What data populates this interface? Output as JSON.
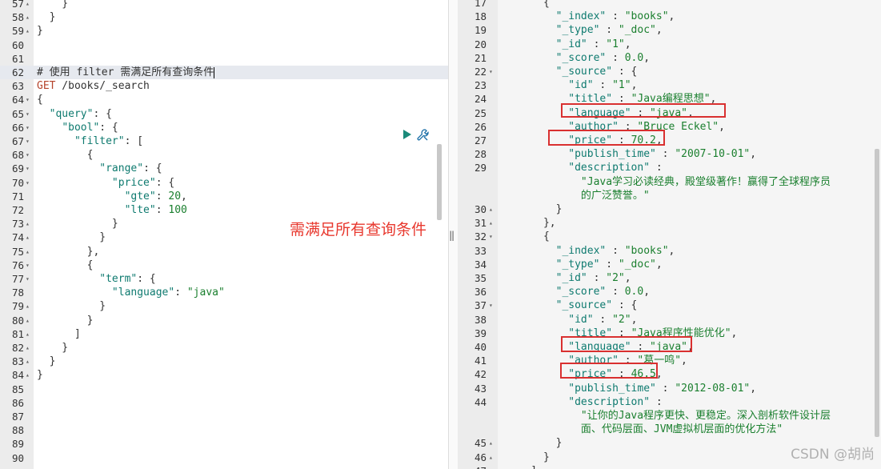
{
  "left_editor": {
    "lines": [
      {
        "n": "57",
        "fold": "▴",
        "segs": [
          {
            "t": "    }",
            "c": "p"
          }
        ]
      },
      {
        "n": "58",
        "fold": "▴",
        "segs": [
          {
            "t": "  }",
            "c": "p"
          }
        ]
      },
      {
        "n": "59",
        "fold": "▴",
        "segs": [
          {
            "t": "}",
            "c": "p"
          }
        ]
      },
      {
        "n": "60",
        "fold": "",
        "segs": []
      },
      {
        "n": "61",
        "fold": "",
        "segs": []
      },
      {
        "n": "62",
        "fold": "",
        "active": true,
        "segs": [
          {
            "t": "# 使用 filter 需满足所有查询条件",
            "c": "c"
          }
        ]
      },
      {
        "n": "63",
        "fold": "",
        "segs": [
          {
            "t": "GET",
            "c": "m"
          },
          {
            "t": " /books/_search",
            "c": "p"
          }
        ]
      },
      {
        "n": "64",
        "fold": "▾",
        "segs": [
          {
            "t": "{",
            "c": "p"
          }
        ]
      },
      {
        "n": "65",
        "fold": "▾",
        "segs": [
          {
            "t": "  ",
            "c": "p"
          },
          {
            "t": "\"query\"",
            "c": "k"
          },
          {
            "t": ": {",
            "c": "p"
          }
        ]
      },
      {
        "n": "66",
        "fold": "▾",
        "segs": [
          {
            "t": "    ",
            "c": "p"
          },
          {
            "t": "\"bool\"",
            "c": "k"
          },
          {
            "t": ": {",
            "c": "p"
          }
        ]
      },
      {
        "n": "67",
        "fold": "▾",
        "segs": [
          {
            "t": "      ",
            "c": "p"
          },
          {
            "t": "\"filter\"",
            "c": "k"
          },
          {
            "t": ": [",
            "c": "p"
          }
        ]
      },
      {
        "n": "68",
        "fold": "▾",
        "segs": [
          {
            "t": "        {",
            "c": "p"
          }
        ]
      },
      {
        "n": "69",
        "fold": "▾",
        "segs": [
          {
            "t": "          ",
            "c": "p"
          },
          {
            "t": "\"range\"",
            "c": "k"
          },
          {
            "t": ": {",
            "c": "p"
          }
        ]
      },
      {
        "n": "70",
        "fold": "▾",
        "segs": [
          {
            "t": "            ",
            "c": "p"
          },
          {
            "t": "\"price\"",
            "c": "k"
          },
          {
            "t": ": {",
            "c": "p"
          }
        ]
      },
      {
        "n": "71",
        "fold": "",
        "segs": [
          {
            "t": "              ",
            "c": "p"
          },
          {
            "t": "\"gte\"",
            "c": "k"
          },
          {
            "t": ": ",
            "c": "p"
          },
          {
            "t": "20",
            "c": "n"
          },
          {
            "t": ",",
            "c": "p"
          }
        ]
      },
      {
        "n": "72",
        "fold": "",
        "segs": [
          {
            "t": "              ",
            "c": "p"
          },
          {
            "t": "\"lte\"",
            "c": "k"
          },
          {
            "t": ": ",
            "c": "p"
          },
          {
            "t": "100",
            "c": "n"
          }
        ]
      },
      {
        "n": "73",
        "fold": "▴",
        "segs": [
          {
            "t": "            }",
            "c": "p"
          }
        ]
      },
      {
        "n": "74",
        "fold": "▴",
        "segs": [
          {
            "t": "          }",
            "c": "p"
          }
        ]
      },
      {
        "n": "75",
        "fold": "▴",
        "segs": [
          {
            "t": "        },",
            "c": "p"
          }
        ]
      },
      {
        "n": "76",
        "fold": "▾",
        "segs": [
          {
            "t": "        {",
            "c": "p"
          }
        ]
      },
      {
        "n": "77",
        "fold": "▾",
        "segs": [
          {
            "t": "          ",
            "c": "p"
          },
          {
            "t": "\"term\"",
            "c": "k"
          },
          {
            "t": ": {",
            "c": "p"
          }
        ]
      },
      {
        "n": "78",
        "fold": "",
        "segs": [
          {
            "t": "            ",
            "c": "p"
          },
          {
            "t": "\"language\"",
            "c": "k"
          },
          {
            "t": ": ",
            "c": "p"
          },
          {
            "t": "\"java\"",
            "c": "s"
          }
        ]
      },
      {
        "n": "79",
        "fold": "▴",
        "segs": [
          {
            "t": "          }",
            "c": "p"
          }
        ]
      },
      {
        "n": "80",
        "fold": "▴",
        "segs": [
          {
            "t": "        }",
            "c": "p"
          }
        ]
      },
      {
        "n": "81",
        "fold": "▴",
        "segs": [
          {
            "t": "      ]",
            "c": "p"
          }
        ]
      },
      {
        "n": "82",
        "fold": "▴",
        "segs": [
          {
            "t": "    }",
            "c": "p"
          }
        ]
      },
      {
        "n": "83",
        "fold": "▴",
        "segs": [
          {
            "t": "  }",
            "c": "p"
          }
        ]
      },
      {
        "n": "84",
        "fold": "▴",
        "segs": [
          {
            "t": "}",
            "c": "p"
          }
        ]
      },
      {
        "n": "85",
        "fold": "",
        "segs": []
      },
      {
        "n": "86",
        "fold": "",
        "segs": []
      },
      {
        "n": "87",
        "fold": "",
        "segs": []
      },
      {
        "n": "88",
        "fold": "",
        "segs": []
      },
      {
        "n": "89",
        "fold": "",
        "segs": []
      },
      {
        "n": "90",
        "fold": "",
        "segs": []
      }
    ]
  },
  "right_editor": {
    "lines": [
      {
        "n": "17",
        "fold": "",
        "segs": [
          {
            "t": "      {",
            "c": "p"
          }
        ]
      },
      {
        "n": "18",
        "fold": "",
        "segs": [
          {
            "t": "        ",
            "c": "p"
          },
          {
            "t": "\"_index\"",
            "c": "k"
          },
          {
            "t": " : ",
            "c": "p"
          },
          {
            "t": "\"books\"",
            "c": "s"
          },
          {
            "t": ",",
            "c": "p"
          }
        ]
      },
      {
        "n": "19",
        "fold": "",
        "segs": [
          {
            "t": "        ",
            "c": "p"
          },
          {
            "t": "\"_type\"",
            "c": "k"
          },
          {
            "t": " : ",
            "c": "p"
          },
          {
            "t": "\"_doc\"",
            "c": "s"
          },
          {
            "t": ",",
            "c": "p"
          }
        ]
      },
      {
        "n": "20",
        "fold": "",
        "segs": [
          {
            "t": "        ",
            "c": "p"
          },
          {
            "t": "\"_id\"",
            "c": "k"
          },
          {
            "t": " : ",
            "c": "p"
          },
          {
            "t": "\"1\"",
            "c": "s"
          },
          {
            "t": ",",
            "c": "p"
          }
        ]
      },
      {
        "n": "21",
        "fold": "",
        "segs": [
          {
            "t": "        ",
            "c": "p"
          },
          {
            "t": "\"_score\"",
            "c": "k"
          },
          {
            "t": " : ",
            "c": "p"
          },
          {
            "t": "0.0",
            "c": "n"
          },
          {
            "t": ",",
            "c": "p"
          }
        ]
      },
      {
        "n": "22",
        "fold": "▾",
        "segs": [
          {
            "t": "        ",
            "c": "p"
          },
          {
            "t": "\"_source\"",
            "c": "k"
          },
          {
            "t": " : {",
            "c": "p"
          }
        ]
      },
      {
        "n": "23",
        "fold": "",
        "segs": [
          {
            "t": "          ",
            "c": "p"
          },
          {
            "t": "\"id\"",
            "c": "k"
          },
          {
            "t": " : ",
            "c": "p"
          },
          {
            "t": "\"1\"",
            "c": "s"
          },
          {
            "t": ",",
            "c": "p"
          }
        ]
      },
      {
        "n": "24",
        "fold": "",
        "segs": [
          {
            "t": "          ",
            "c": "p"
          },
          {
            "t": "\"title\"",
            "c": "k"
          },
          {
            "t": " : ",
            "c": "p"
          },
          {
            "t": "\"Java编程思想\"",
            "c": "s"
          },
          {
            "t": ",",
            "c": "p"
          }
        ]
      },
      {
        "n": "25",
        "fold": "",
        "segs": [
          {
            "t": "          ",
            "c": "p"
          },
          {
            "t": "\"language\"",
            "c": "k"
          },
          {
            "t": " : ",
            "c": "p"
          },
          {
            "t": "\"java\"",
            "c": "s"
          },
          {
            "t": ",",
            "c": "p"
          }
        ]
      },
      {
        "n": "26",
        "fold": "",
        "segs": [
          {
            "t": "          ",
            "c": "p"
          },
          {
            "t": "\"author\"",
            "c": "k"
          },
          {
            "t": " : ",
            "c": "p"
          },
          {
            "t": "\"Bruce Eckel\"",
            "c": "s"
          },
          {
            "t": ",",
            "c": "p"
          }
        ]
      },
      {
        "n": "27",
        "fold": "",
        "segs": [
          {
            "t": "          ",
            "c": "p"
          },
          {
            "t": "\"price\"",
            "c": "k"
          },
          {
            "t": " : ",
            "c": "p"
          },
          {
            "t": "70.2",
            "c": "n"
          },
          {
            "t": ",",
            "c": "p"
          }
        ]
      },
      {
        "n": "28",
        "fold": "",
        "segs": [
          {
            "t": "          ",
            "c": "p"
          },
          {
            "t": "\"publish_time\"",
            "c": "k"
          },
          {
            "t": " : ",
            "c": "p"
          },
          {
            "t": "\"2007-10-01\"",
            "c": "s"
          },
          {
            "t": ",",
            "c": "p"
          }
        ]
      },
      {
        "n": "29",
        "fold": "",
        "segs": [
          {
            "t": "          ",
            "c": "p"
          },
          {
            "t": "\"description\"",
            "c": "k"
          },
          {
            "t": " :",
            "c": "p"
          }
        ]
      },
      {
        "n": "",
        "fold": "",
        "segs": [
          {
            "t": "            ",
            "c": "p"
          },
          {
            "t": "\"Java学习必读经典，殿堂级著作！赢得了全球程序员",
            "c": "s"
          }
        ]
      },
      {
        "n": "",
        "fold": "",
        "segs": [
          {
            "t": "            ",
            "c": "p"
          },
          {
            "t": "的广泛赞誉。\"",
            "c": "s"
          }
        ]
      },
      {
        "n": "30",
        "fold": "▴",
        "segs": [
          {
            "t": "        }",
            "c": "p"
          }
        ]
      },
      {
        "n": "31",
        "fold": "▴",
        "segs": [
          {
            "t": "      },",
            "c": "p"
          }
        ]
      },
      {
        "n": "32",
        "fold": "▾",
        "segs": [
          {
            "t": "      {",
            "c": "p"
          }
        ]
      },
      {
        "n": "33",
        "fold": "",
        "segs": [
          {
            "t": "        ",
            "c": "p"
          },
          {
            "t": "\"_index\"",
            "c": "k"
          },
          {
            "t": " : ",
            "c": "p"
          },
          {
            "t": "\"books\"",
            "c": "s"
          },
          {
            "t": ",",
            "c": "p"
          }
        ]
      },
      {
        "n": "34",
        "fold": "",
        "segs": [
          {
            "t": "        ",
            "c": "p"
          },
          {
            "t": "\"_type\"",
            "c": "k"
          },
          {
            "t": " : ",
            "c": "p"
          },
          {
            "t": "\"_doc\"",
            "c": "s"
          },
          {
            "t": ",",
            "c": "p"
          }
        ]
      },
      {
        "n": "35",
        "fold": "",
        "segs": [
          {
            "t": "        ",
            "c": "p"
          },
          {
            "t": "\"_id\"",
            "c": "k"
          },
          {
            "t": " : ",
            "c": "p"
          },
          {
            "t": "\"2\"",
            "c": "s"
          },
          {
            "t": ",",
            "c": "p"
          }
        ]
      },
      {
        "n": "36",
        "fold": "",
        "segs": [
          {
            "t": "        ",
            "c": "p"
          },
          {
            "t": "\"_score\"",
            "c": "k"
          },
          {
            "t": " : ",
            "c": "p"
          },
          {
            "t": "0.0",
            "c": "n"
          },
          {
            "t": ",",
            "c": "p"
          }
        ]
      },
      {
        "n": "37",
        "fold": "▾",
        "segs": [
          {
            "t": "        ",
            "c": "p"
          },
          {
            "t": "\"_source\"",
            "c": "k"
          },
          {
            "t": " : {",
            "c": "p"
          }
        ]
      },
      {
        "n": "38",
        "fold": "",
        "segs": [
          {
            "t": "          ",
            "c": "p"
          },
          {
            "t": "\"id\"",
            "c": "k"
          },
          {
            "t": " : ",
            "c": "p"
          },
          {
            "t": "\"2\"",
            "c": "s"
          },
          {
            "t": ",",
            "c": "p"
          }
        ]
      },
      {
        "n": "39",
        "fold": "",
        "segs": [
          {
            "t": "          ",
            "c": "p"
          },
          {
            "t": "\"title\"",
            "c": "k"
          },
          {
            "t": " : ",
            "c": "p"
          },
          {
            "t": "\"Java程序性能优化\"",
            "c": "s"
          },
          {
            "t": ",",
            "c": "p"
          }
        ]
      },
      {
        "n": "40",
        "fold": "",
        "segs": [
          {
            "t": "          ",
            "c": "p"
          },
          {
            "t": "\"language\"",
            "c": "k"
          },
          {
            "t": " : ",
            "c": "p"
          },
          {
            "t": "\"java\"",
            "c": "s"
          },
          {
            "t": ",",
            "c": "p"
          }
        ]
      },
      {
        "n": "41",
        "fold": "",
        "segs": [
          {
            "t": "          ",
            "c": "p"
          },
          {
            "t": "\"author\"",
            "c": "k"
          },
          {
            "t": " : ",
            "c": "p"
          },
          {
            "t": "\"葛一鸣\"",
            "c": "s"
          },
          {
            "t": ",",
            "c": "p"
          }
        ]
      },
      {
        "n": "42",
        "fold": "",
        "segs": [
          {
            "t": "          ",
            "c": "p"
          },
          {
            "t": "\"price\"",
            "c": "k"
          },
          {
            "t": " : ",
            "c": "p"
          },
          {
            "t": "46.5",
            "c": "n"
          },
          {
            "t": ",",
            "c": "p"
          }
        ]
      },
      {
        "n": "43",
        "fold": "",
        "segs": [
          {
            "t": "          ",
            "c": "p"
          },
          {
            "t": "\"publish_time\"",
            "c": "k"
          },
          {
            "t": " : ",
            "c": "p"
          },
          {
            "t": "\"2012-08-01\"",
            "c": "s"
          },
          {
            "t": ",",
            "c": "p"
          }
        ]
      },
      {
        "n": "44",
        "fold": "",
        "segs": [
          {
            "t": "          ",
            "c": "p"
          },
          {
            "t": "\"description\"",
            "c": "k"
          },
          {
            "t": " :",
            "c": "p"
          }
        ]
      },
      {
        "n": "",
        "fold": "",
        "segs": [
          {
            "t": "            ",
            "c": "p"
          },
          {
            "t": "\"让你的Java程序更快、更稳定。深入剖析软件设计层",
            "c": "s"
          }
        ]
      },
      {
        "n": "",
        "fold": "",
        "segs": [
          {
            "t": "            ",
            "c": "p"
          },
          {
            "t": "面、代码层面、JVM虚拟机层面的优化方法\"",
            "c": "s"
          }
        ]
      },
      {
        "n": "45",
        "fold": "▴",
        "segs": [
          {
            "t": "        }",
            "c": "p"
          }
        ]
      },
      {
        "n": "46",
        "fold": "▴",
        "segs": [
          {
            "t": "      }",
            "c": "p"
          }
        ]
      },
      {
        "n": "47",
        "fold": "▴",
        "segs": [
          {
            "t": "    ]",
            "c": "p"
          }
        ]
      }
    ]
  },
  "annotation_text": "需满足所有查询条件",
  "watermark": "CSDN @胡尚",
  "colors": {
    "key": "#0e7a6f",
    "string": "#1a7f2e",
    "method": "#b5442c",
    "annotation": "#e8382e",
    "highlight_box": "#d93030"
  },
  "icons": {
    "run": "play-icon",
    "settings": "wrench-icon",
    "resize": "resize-handle-icon"
  }
}
